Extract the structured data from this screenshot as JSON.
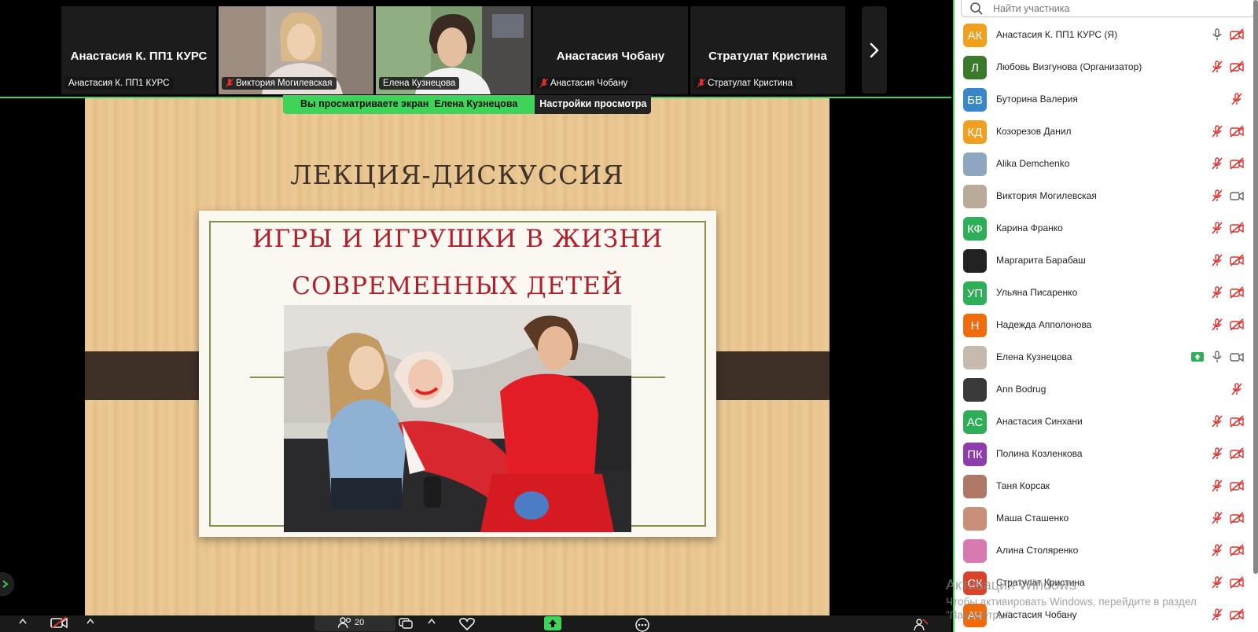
{
  "strip": {
    "tiles": [
      {
        "big_name": "Анастасия К. ПП1 КУРС",
        "tag": "Анастасия К. ПП1 КУРС"
      },
      {
        "big_name": "",
        "tag": "Виктория Могилевская"
      },
      {
        "big_name": "",
        "tag": "Елена Кузнецова"
      },
      {
        "big_name": "Анастасия Чобану",
        "tag": "Анастасия Чобану"
      },
      {
        "big_name": "Стратулат Кристина",
        "tag": "Стратулат Кристина"
      }
    ]
  },
  "share_bar": {
    "viewing_text": "Вы просматриваете экран",
    "presenter": "Елена Кузнецова",
    "settings_label": "Настройки просмотра"
  },
  "slide": {
    "heading": "ЛЕКЦИЯ-ДИСКУССИЯ",
    "title_line1": "ИГРЫ И ИГРУШКИ В ЖИЗНИ",
    "title_line2": "СОВРЕМЕННЫХ ДЕТЕЙ"
  },
  "toolbar": {
    "participants_count": "20"
  },
  "panel": {
    "search_placeholder": "Найти участника",
    "participants": [
      {
        "initials": "АК",
        "name": "Анастасия К. ПП1 КУРС (Я)",
        "color": "#f0a01e",
        "mic": "on",
        "cam": "off"
      },
      {
        "initials": "Л",
        "name": "Любовь Визгунова (Организатор)",
        "color": "#3b7a2c",
        "mic": "off",
        "cam": "off"
      },
      {
        "initials": "БВ",
        "name": "Буторина Валерия",
        "color": "#3a86c8",
        "mic": "off",
        "cam": "none"
      },
      {
        "initials": "КД",
        "name": "Козорезов Данил",
        "color": "#f0a01e",
        "mic": "off",
        "cam": "off"
      },
      {
        "initials": "",
        "name": "Alika Demchenko",
        "color": "#8fa6c0",
        "mic": "off",
        "cam": "off"
      },
      {
        "initials": "",
        "name": "Виктория Могилевская",
        "color": "#b9aa9a",
        "mic": "off",
        "cam": "on"
      },
      {
        "initials": "КФ",
        "name": "Карина Франко",
        "color": "#2fae5a",
        "mic": "off",
        "cam": "off"
      },
      {
        "initials": "",
        "name": "Маргарита Барабаш",
        "color": "#222222",
        "mic": "off",
        "cam": "off"
      },
      {
        "initials": "УП",
        "name": "Ульяна Писаренко",
        "color": "#2fae5a",
        "mic": "off",
        "cam": "off"
      },
      {
        "initials": "Н",
        "name": "Надежда Апполонова",
        "color": "#ef6c0c",
        "mic": "off",
        "cam": "off"
      },
      {
        "initials": "",
        "name": "Елена Кузнецова",
        "color": "#c7b9ad",
        "mic": "on",
        "cam": "on",
        "sharing": true
      },
      {
        "initials": "",
        "name": "Ann Bodrug",
        "color": "#3a3a3a",
        "mic": "off",
        "cam": "none"
      },
      {
        "initials": "АС",
        "name": "Анастасия Синхани",
        "color": "#2fae5a",
        "mic": "off",
        "cam": "off"
      },
      {
        "initials": "ПК",
        "name": "Полина Козленкова",
        "color": "#8e3dad",
        "mic": "off",
        "cam": "off"
      },
      {
        "initials": "",
        "name": "Таня Корсак",
        "color": "#b07866",
        "mic": "off",
        "cam": "off"
      },
      {
        "initials": "",
        "name": "Маша Сташенко",
        "color": "#c98f7a",
        "mic": "off",
        "cam": "off"
      },
      {
        "initials": "",
        "name": "Алина Столяренко",
        "color": "#d87ab0",
        "mic": "off",
        "cam": "off"
      },
      {
        "initials": "СК",
        "name": "Стратулат Кристина",
        "color": "#d9432a",
        "mic": "off",
        "cam": "off"
      },
      {
        "initials": "АЧ",
        "name": "Анастасия Чобану",
        "color": "#ef6c0c",
        "mic": "off",
        "cam": "off"
      }
    ]
  },
  "watermark": {
    "line1": "Активация Windows",
    "line2": "Чтобы активировать Windows, перейдите в раздел",
    "line3": "\"Параметры\"."
  },
  "colors": {
    "accent_green": "#3fd35a",
    "muted_red": "#e0302c",
    "slide_title_red": "#b0202b"
  }
}
